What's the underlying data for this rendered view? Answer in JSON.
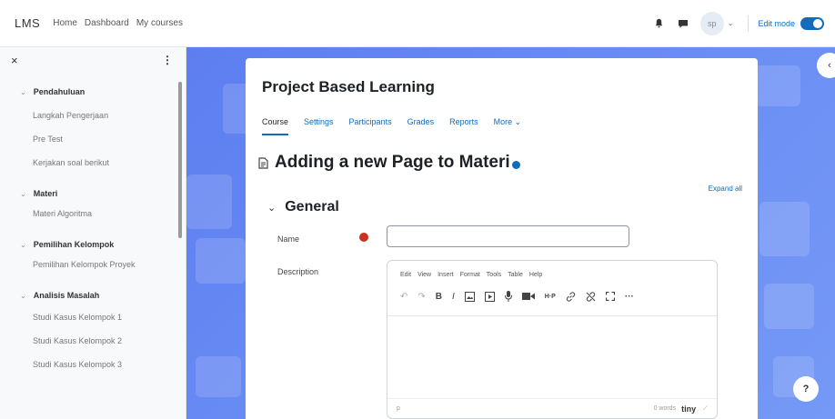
{
  "navbar": {
    "brand": "LMS",
    "links": [
      "Home",
      "Dashboard",
      "My courses"
    ],
    "avatar_initials": "sp",
    "edit_mode_label": "Edit mode",
    "edit_mode_on": true
  },
  "drawer": {
    "sections": [
      {
        "title": "Pendahuluan",
        "items": [
          "Langkah Pengerjaan",
          "Pre Test",
          "Kerjakan soal berikut"
        ]
      },
      {
        "title": "Materi",
        "items": [
          "Materi Algoritma"
        ]
      },
      {
        "title": "Pemilihan Kelompok",
        "items": [
          "Pemilihan Kelompok Proyek"
        ]
      },
      {
        "title": "Analisis Masalah",
        "items": [
          "Studi Kasus Kelompok 1",
          "Studi Kasus Kelompok 2",
          "Studi Kasus Kelompok 3"
        ]
      }
    ]
  },
  "course": {
    "title": "Project Based Learning",
    "tabs": [
      {
        "label": "Course",
        "active": true
      },
      {
        "label": "Settings",
        "active": false
      },
      {
        "label": "Participants",
        "active": false
      },
      {
        "label": "Grades",
        "active": false
      },
      {
        "label": "Reports",
        "active": false
      },
      {
        "label": "More ⌄",
        "active": false
      }
    ]
  },
  "form": {
    "heading": "Adding a new Page to Materi",
    "expand_all": "Expand all",
    "general_label": "General",
    "name_label": "Name",
    "name_value": "",
    "description_label": "Description"
  },
  "editor": {
    "menu": [
      "Edit",
      "View",
      "Insert",
      "Format",
      "Tools",
      "Table",
      "Help"
    ],
    "path": "p",
    "word_count": "0 words",
    "brand": "tiny"
  },
  "colors": {
    "accent": "#0f6cbf",
    "required": "#ca3120",
    "background": "#6a8df4"
  },
  "icons": {
    "notifications": "bell-icon",
    "messages": "chat-icon",
    "help": "question-icon"
  }
}
